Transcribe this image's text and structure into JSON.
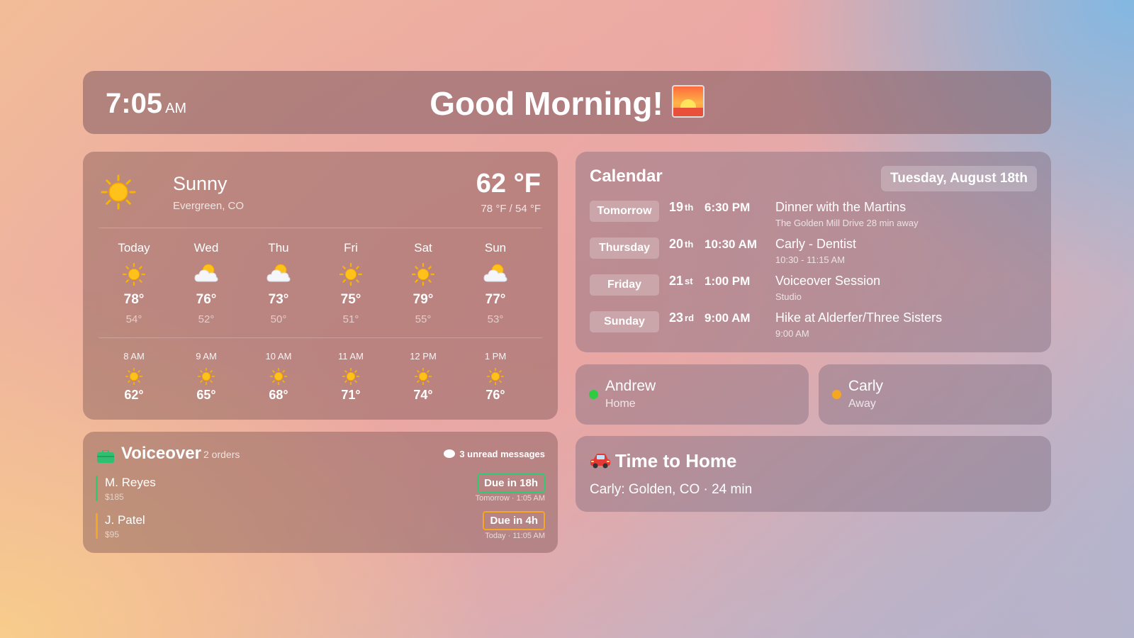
{
  "header": {
    "time": "7:05",
    "ampm": "AM",
    "greeting": "Good Morning!",
    "greeting_icon": "sunrise-icon"
  },
  "weather": {
    "condition": "Sunny",
    "location": "Evergreen, CO",
    "temp": "62 °F",
    "hilo": "78 °F / 54 °F",
    "condition_icon": "sun-icon",
    "days": [
      {
        "name": "Today",
        "icon": "sun",
        "hi": "78°",
        "lo": "54°"
      },
      {
        "name": "Wed",
        "icon": "partly-cloudy",
        "hi": "76°",
        "lo": "52°"
      },
      {
        "name": "Thu",
        "icon": "partly-cloudy",
        "hi": "73°",
        "lo": "50°"
      },
      {
        "name": "Fri",
        "icon": "sun",
        "hi": "75°",
        "lo": "51°"
      },
      {
        "name": "Sat",
        "icon": "sun",
        "hi": "79°",
        "lo": "55°"
      },
      {
        "name": "Sun",
        "icon": "partly-cloudy",
        "hi": "77°",
        "lo": "53°"
      }
    ],
    "hours": [
      {
        "time": "8 AM",
        "icon": "sun",
        "temp": "62°"
      },
      {
        "time": "9 AM",
        "icon": "sun",
        "temp": "65°"
      },
      {
        "time": "10 AM",
        "icon": "sun",
        "temp": "68°"
      },
      {
        "time": "11 AM",
        "icon": "sun",
        "temp": "71°"
      },
      {
        "time": "12 PM",
        "icon": "sun",
        "temp": "74°"
      },
      {
        "time": "1 PM",
        "icon": "sun",
        "temp": "76°"
      }
    ]
  },
  "voiceover": {
    "title": "Voiceover",
    "count": "2 orders",
    "messages": "3 unread messages",
    "icon": "briefcase-icon",
    "orders": [
      {
        "name": "M. Reyes",
        "price": "$185",
        "due": "Due in 18h",
        "when": "Tomorrow · 1:05 AM",
        "color": "#2ecc71"
      },
      {
        "name": "J. Patel",
        "price": "$95",
        "due": "Due in 4h",
        "when": "Today · 11:05 AM",
        "color": "#f5a623"
      }
    ]
  },
  "calendar": {
    "title": "Calendar",
    "date": "Tuesday, August 18th",
    "events": [
      {
        "day": "Tomorrow",
        "date": "19",
        "suffix": "th",
        "time": "6:30 PM",
        "title": "Dinner with the Martins",
        "sub": "The Golden Mill  Drive 28 min away"
      },
      {
        "day": "Thursday",
        "date": "20",
        "suffix": "th",
        "time": "10:30 AM",
        "title": "Carly - Dentist",
        "sub": "10:30 - 11:15 AM"
      },
      {
        "day": "Friday",
        "date": "21",
        "suffix": "st",
        "time": "1:00 PM",
        "title": "Voiceover Session",
        "sub": "Studio"
      },
      {
        "day": "Sunday",
        "date": "23",
        "suffix": "rd",
        "time": "9:00 AM",
        "title": "Hike at Alderfer/Three Sisters",
        "sub": "9:00 AM"
      }
    ]
  },
  "presence": [
    {
      "name": "Andrew",
      "status": "Home",
      "color": "#2ecc40"
    },
    {
      "name": "Carly",
      "status": "Away",
      "color": "#f5a623"
    }
  ],
  "time_to_home": {
    "title": "Time to Home",
    "icon": "car-icon",
    "detail": "Carly: Golden, CO · 24 min"
  }
}
